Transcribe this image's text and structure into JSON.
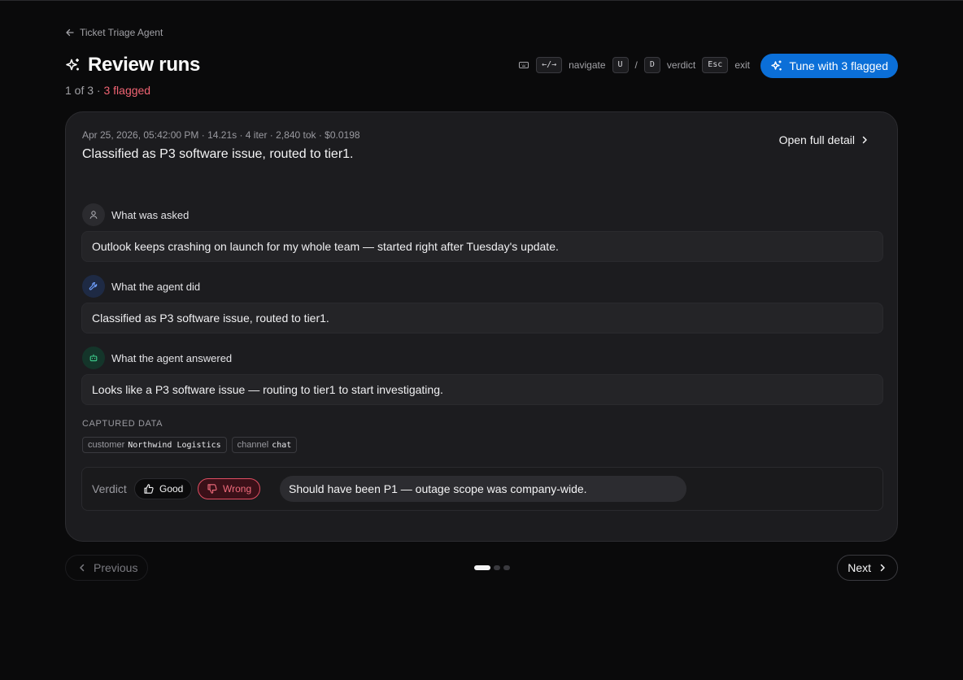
{
  "breadcrumb": {
    "label": "Ticket Triage Agent"
  },
  "header": {
    "title": "Review runs",
    "position": "1 of 3",
    "separator": " · ",
    "flagged": "3 flagged"
  },
  "shortcuts": {
    "navigate_key": "←/→",
    "navigate_label": "navigate",
    "up_key": "U",
    "slash": "/",
    "down_key": "D",
    "verdict_label": "verdict",
    "exit_key": "Esc",
    "exit_label": "exit"
  },
  "tune_button": {
    "label": "Tune with 3 flagged"
  },
  "run": {
    "meta": "Apr 25, 2026, 05:42:00 PM · 14.21s · 4 iter · 2,840 tok · $0.0198",
    "summary": "Classified as P3 software issue, routed to tier1.",
    "open_detail": "Open full detail",
    "asked": {
      "heading": "What was asked",
      "text": "Outlook keeps crashing on launch for my whole team — started right after Tuesday's update."
    },
    "did": {
      "heading": "What the agent did",
      "text": "Classified as P3 software issue, routed to tier1."
    },
    "answered": {
      "heading": "What the agent answered",
      "text": "Looks like a P3 software issue — routing to tier1 to start investigating."
    },
    "captured": {
      "label": "CAPTURED DATA",
      "fields": [
        {
          "key": "customer",
          "value": "Northwind Logistics"
        },
        {
          "key": "channel",
          "value": "chat"
        }
      ]
    },
    "verdict": {
      "label": "Verdict",
      "good": "Good",
      "wrong": "Wrong",
      "selected": "wrong",
      "note": "Should have been P1 — outage scope was company-wide."
    }
  },
  "pager": {
    "previous": "Previous",
    "next": "Next",
    "total": 3,
    "current": 1
  },
  "colors": {
    "accent": "#0b6fd8",
    "flagged": "#f06473",
    "wrong": "#e04e62"
  }
}
